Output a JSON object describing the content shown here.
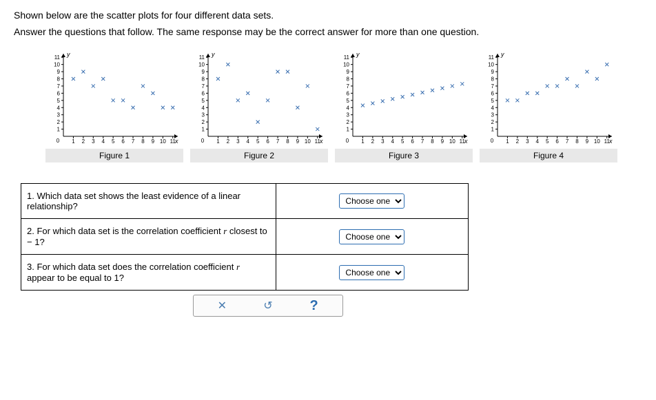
{
  "intro": {
    "line1": "Shown below are the scatter plots for four different data sets.",
    "line2": "Answer the questions that follow. The same response may be the correct answer for more than one question."
  },
  "axis": {
    "ticks": [
      0,
      1,
      2,
      3,
      4,
      5,
      6,
      7,
      8,
      9,
      10,
      11
    ],
    "ylabel": "y",
    "xlabel": "x"
  },
  "figures": [
    {
      "caption": "Figure 1"
    },
    {
      "caption": "Figure 2"
    },
    {
      "caption": "Figure 3"
    },
    {
      "caption": "Figure 4"
    }
  ],
  "chart_data": [
    {
      "type": "scatter",
      "title": "Figure 1",
      "xlabel": "x",
      "ylabel": "y",
      "xlim": [
        0,
        11
      ],
      "ylim": [
        0,
        11
      ],
      "points": [
        {
          "x": 1,
          "y": 8
        },
        {
          "x": 2,
          "y": 9
        },
        {
          "x": 3,
          "y": 7
        },
        {
          "x": 4,
          "y": 8
        },
        {
          "x": 5,
          "y": 5
        },
        {
          "x": 6,
          "y": 5
        },
        {
          "x": 7,
          "y": 4
        },
        {
          "x": 8,
          "y": 7
        },
        {
          "x": 9,
          "y": 6
        },
        {
          "x": 10,
          "y": 4
        },
        {
          "x": 11,
          "y": 4
        }
      ]
    },
    {
      "type": "scatter",
      "title": "Figure 2",
      "xlabel": "x",
      "ylabel": "y",
      "xlim": [
        0,
        11
      ],
      "ylim": [
        0,
        11
      ],
      "points": [
        {
          "x": 1,
          "y": 8
        },
        {
          "x": 2,
          "y": 10
        },
        {
          "x": 3,
          "y": 5
        },
        {
          "x": 4,
          "y": 6
        },
        {
          "x": 5,
          "y": 2
        },
        {
          "x": 6,
          "y": 5
        },
        {
          "x": 7,
          "y": 9
        },
        {
          "x": 8,
          "y": 9
        },
        {
          "x": 9,
          "y": 4
        },
        {
          "x": 10,
          "y": 7
        },
        {
          "x": 11,
          "y": 1
        }
      ]
    },
    {
      "type": "scatter",
      "title": "Figure 3",
      "xlabel": "x",
      "ylabel": "y",
      "xlim": [
        0,
        11
      ],
      "ylim": [
        0,
        11
      ],
      "points": [
        {
          "x": 1,
          "y": 4.3
        },
        {
          "x": 2,
          "y": 4.6
        },
        {
          "x": 3,
          "y": 4.9
        },
        {
          "x": 4,
          "y": 5.2
        },
        {
          "x": 5,
          "y": 5.5
        },
        {
          "x": 6,
          "y": 5.8
        },
        {
          "x": 7,
          "y": 6.1
        },
        {
          "x": 8,
          "y": 6.4
        },
        {
          "x": 9,
          "y": 6.7
        },
        {
          "x": 10,
          "y": 7.0
        },
        {
          "x": 11,
          "y": 7.3
        }
      ]
    },
    {
      "type": "scatter",
      "title": "Figure 4",
      "xlabel": "x",
      "ylabel": "y",
      "xlim": [
        0,
        11
      ],
      "ylim": [
        0,
        11
      ],
      "points": [
        {
          "x": 1,
          "y": 5
        },
        {
          "x": 2,
          "y": 5
        },
        {
          "x": 3,
          "y": 6
        },
        {
          "x": 4,
          "y": 6
        },
        {
          "x": 5,
          "y": 7
        },
        {
          "x": 6,
          "y": 7
        },
        {
          "x": 7,
          "y": 8
        },
        {
          "x": 8,
          "y": 7
        },
        {
          "x": 9,
          "y": 9
        },
        {
          "x": 10,
          "y": 8
        },
        {
          "x": 11,
          "y": 10
        }
      ]
    }
  ],
  "questions": {
    "q1": {
      "prefix": "1. Which data set shows the least evidence of a linear relationship?"
    },
    "q2": {
      "prefix": "2. For which data set is the correlation coefficient ",
      "r": "r",
      "mid": " closest to ",
      "neg1": "− 1",
      "suffix": "?"
    },
    "q3": {
      "prefix": "3. For which data set does the correlation coefficient ",
      "r": "r",
      "mid": " appear to be equal to ",
      "one": "1",
      "suffix": "?"
    },
    "select_placeholder": "Choose one"
  },
  "toolbar": {
    "close": "✕",
    "reset": "↺",
    "help": "?"
  }
}
